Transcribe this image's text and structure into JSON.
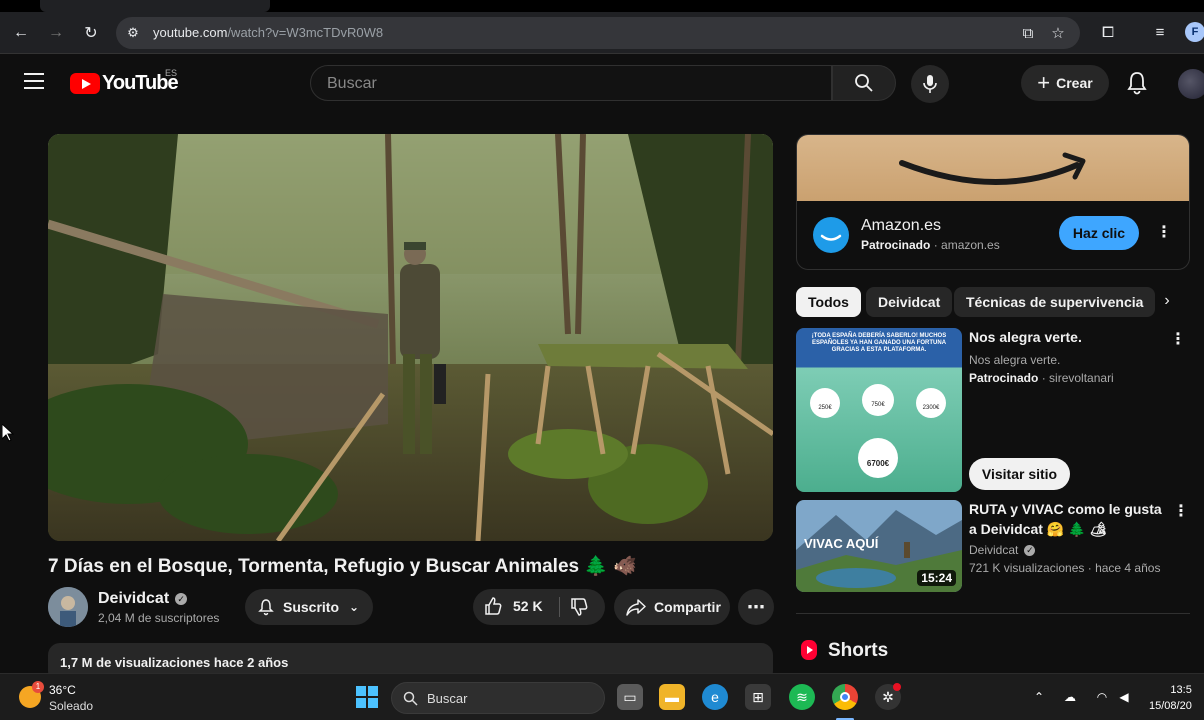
{
  "browser": {
    "url_host": "youtube.com",
    "url_path": "/watch?v=W3mcTDvR0W8",
    "profile_initial": "F"
  },
  "header": {
    "logo_text": "YouTube",
    "logo_country": "ES",
    "search_placeholder": "Buscar",
    "create_label": "Crear"
  },
  "video": {
    "title": "7 Días en el Bosque, Tormenta, Refugio y Buscar Animales 🌲 🐗",
    "channel_name": "Deividcat",
    "subscribers": "2,04 M de suscriptores",
    "subscribed_label": "Suscrito",
    "likes": "52 K",
    "share_label": "Compartir",
    "views_date": "1,7 M de visualizaciones  hace 2 años"
  },
  "sidebar": {
    "ad": {
      "advertiser": "Amazon.es",
      "sponsored_label": "Patrocinado",
      "domain": "amazon.es",
      "cta": "Haz clic"
    },
    "chips": [
      "Todos",
      "Deividcat",
      "Técnicas de supervivencia"
    ],
    "items": [
      {
        "title": "Nos alegra verte.",
        "line1": "Nos alegra verte.",
        "sponsored_label": "Patrocinado",
        "domain": "sirevoltanari",
        "cta": "Visitar sitio",
        "thumb_headline": "¡TODA ESPAÑA DEBERÍA SABERLO! MUCHOS ESPAÑOLES YA HAN GANADO UNA FORTUNA GRACIAS A ESTA PLATAFORMA.",
        "thumb_amounts": [
          "250€",
          "750€",
          "2300€",
          "6700€"
        ]
      },
      {
        "title": "RUTA y VIVAC como le gusta a Deividcat 🤗 🌲 🏕",
        "channel": "Deividcat",
        "meta": "721 K visualizaciones · hace 4 años",
        "duration": "15:24",
        "thumb_text": "VIVAC AQUÍ"
      }
    ],
    "shorts_label": "Shorts"
  },
  "taskbar": {
    "temperature": "36°C",
    "condition": "Soleado",
    "weather_badge": "1",
    "search_label": "Buscar",
    "time": "13:5",
    "date": "15/08/20"
  }
}
